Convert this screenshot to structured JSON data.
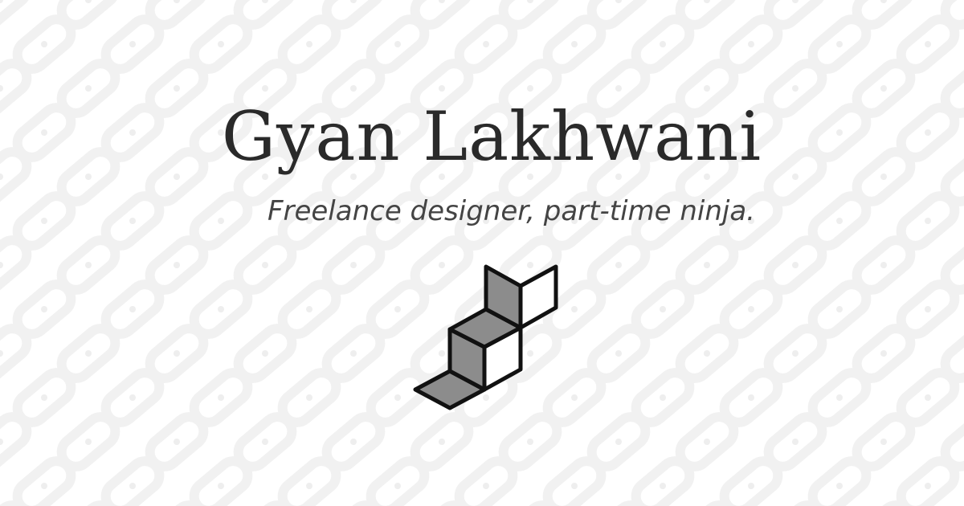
{
  "header": {
    "name": "Gyan Lakhwani",
    "tagline": "Freelance designer, part-time ninja."
  },
  "logo": {
    "icon": "stacked-cubes-icon"
  },
  "background": {
    "icon": "chain-link-pattern",
    "color": "#ffffff",
    "pattern_color": "#f3f3f3"
  },
  "colors": {
    "text": "#2a2a2a",
    "logo_stroke": "#111111",
    "logo_fill": "#8c8c8c"
  }
}
